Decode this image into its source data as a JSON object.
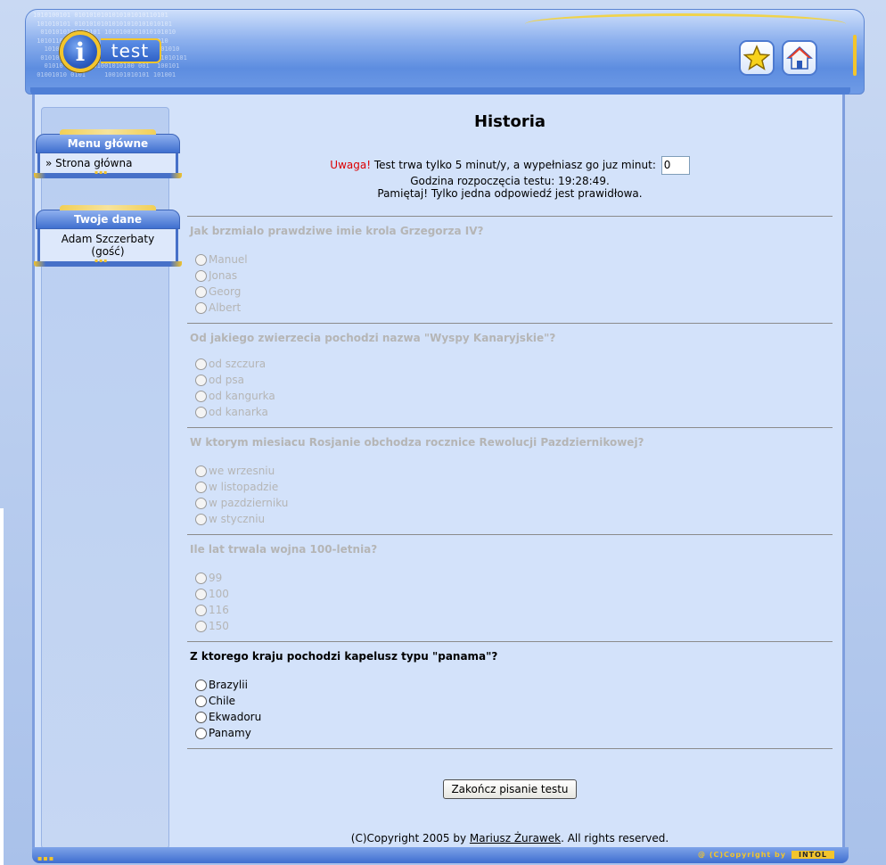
{
  "header": {
    "logo_letter": "i",
    "logo_text": "test",
    "favorites_icon": "star-icon",
    "home_icon": "home-icon"
  },
  "sidebar": {
    "menu_title": "Menu główne",
    "menu_items": [
      {
        "prefix": "»",
        "label": "Strona główna"
      }
    ],
    "user_title": "Twoje dane",
    "user_name": "Adam Szczerbaty",
    "user_role": "(gość)"
  },
  "main": {
    "title": "Historia",
    "warning_label": "Uwaga!",
    "warning_text": "Test trwa tylko 5 minut/y, a wypełniasz go juz minut:",
    "minutes_value": "0",
    "start_time": "Godzina rozpoczęcia testu: 19:28:49.",
    "note": "Pamiętaj! Tylko jedna odpowiedź jest prawidłowa."
  },
  "questions": [
    {
      "text": "Jak brzmialo prawdziwe imie krola Grzegorza IV?",
      "disabled": true,
      "options": [
        "Manuel",
        "Jonas",
        "Georg",
        "Albert"
      ]
    },
    {
      "text": "Od jakiego zwierzecia pochodzi nazwa \"Wyspy Kanaryjskie\"?",
      "disabled": true,
      "options": [
        "od szczura",
        "od psa",
        "od kangurka",
        "od kanarka"
      ]
    },
    {
      "text": "W ktorym miesiacu Rosjanie obchodza rocznice Rewolucji Pazdziernikowej?",
      "disabled": true,
      "options": [
        "we wrzesniu",
        "w listopadzie",
        "w pazdzierniku",
        "w styczniu"
      ]
    },
    {
      "text": "Ile lat trwala wojna 100-letnia?",
      "disabled": true,
      "options": [
        "99",
        "100",
        "116",
        "150"
      ]
    },
    {
      "text": "Z ktorego kraju pochodzi kapelusz typu \"panama\"?",
      "disabled": false,
      "options": [
        "Brazylii",
        "Chile",
        "Ekwadoru",
        "Panamy"
      ]
    }
  ],
  "submit_label": "Zakończ pisanie testu",
  "footer": {
    "prefix": "(C)Copyright 2005 by",
    "author": "Mariusz Żurawek",
    "suffix": ". All rights reserved."
  },
  "badge": {
    "copyright": "@ (C)Copyright by",
    "company": "INTOL"
  }
}
